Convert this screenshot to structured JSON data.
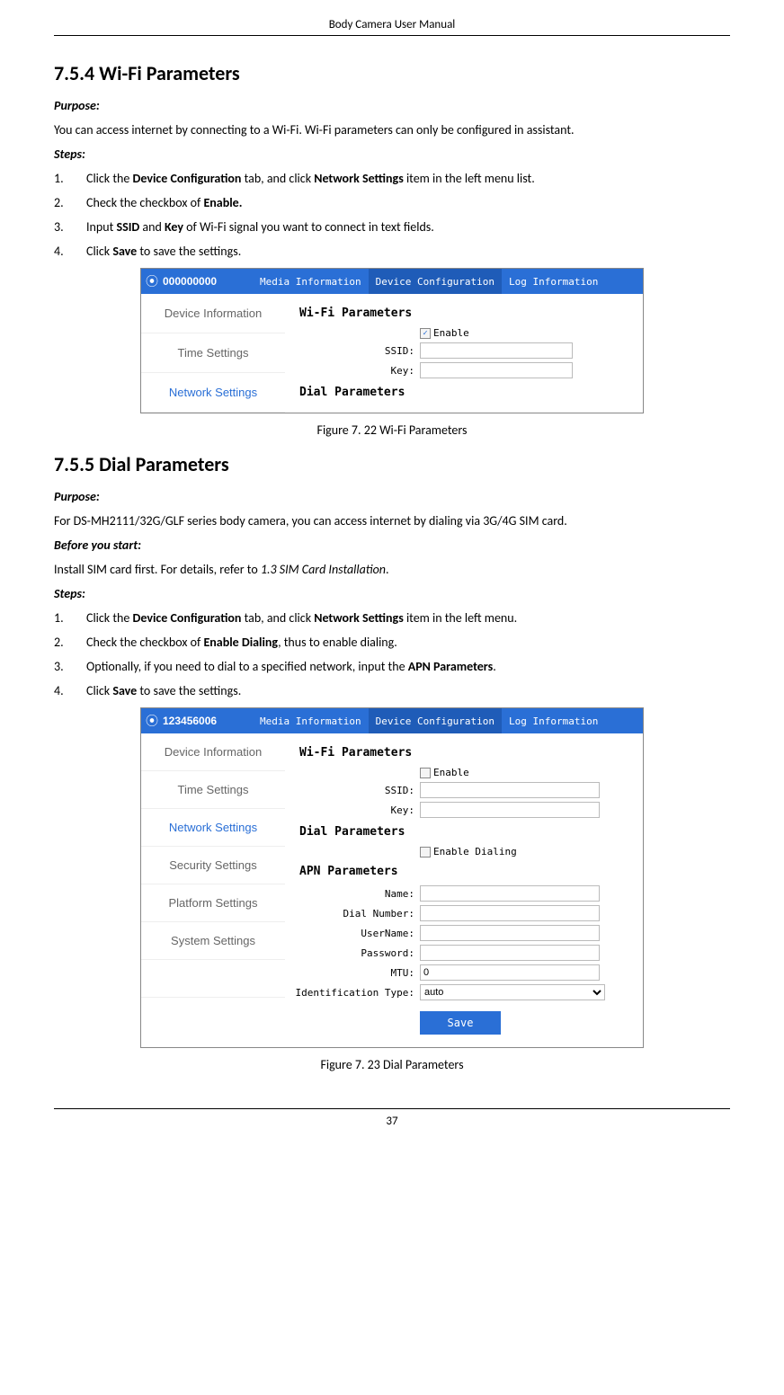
{
  "header": {
    "title": "Body Camera User Manual"
  },
  "section1": {
    "heading": "7.5.4  Wi-Fi Parameters",
    "purpose_label": "Purpose:",
    "purpose_text": "You can access internet by connecting to a Wi-Fi. Wi-Fi parameters can only be configured in assistant.",
    "steps_label": "Steps:",
    "steps": [
      {
        "pre": "Click the ",
        "b1": "Device Configuration",
        "mid": " tab, and click ",
        "b2": "Network Settings",
        "post": " item in the left menu list."
      },
      {
        "pre": "Check the checkbox of ",
        "b1": "Enable.",
        "mid": "",
        "b2": "",
        "post": ""
      },
      {
        "pre": "Input ",
        "b1": "SSID",
        "mid": " and ",
        "b2": "Key",
        "post": " of Wi-Fi signal you want to connect in text fields."
      },
      {
        "pre": "Click ",
        "b1": "Save",
        "mid": " to save the settings.",
        "b2": "",
        "post": ""
      }
    ],
    "figure_caption": "Figure 7. 22 Wi-Fi Parameters"
  },
  "shot1": {
    "device_id": "000000000",
    "tabs": [
      "Media Information",
      "Device Configuration",
      "Log Information"
    ],
    "sidebar": [
      "Device Information",
      "Time Settings",
      "Network Settings"
    ],
    "wifi_title": "Wi-Fi Parameters",
    "enable_label": "Enable",
    "enable_checked": true,
    "ssid_label": "SSID:",
    "ssid_value": "",
    "key_label": "Key:",
    "key_value": "",
    "dial_title": "Dial Parameters"
  },
  "section2": {
    "heading": "7.5.5  Dial Parameters",
    "purpose_label": "Purpose:",
    "purpose_text": "For DS-MH2111/32G/GLF series body camera, you can access internet by dialing via 3G/4G SIM card.",
    "before_label": "Before you start:",
    "before_text_pre": "Install SIM card first. For details, refer to ",
    "before_text_ref": "1.3 SIM Card Installation",
    "before_text_post": ".",
    "steps_label": "Steps:",
    "steps": [
      {
        "pre": "Click the ",
        "b1": "Device Configuration",
        "mid": " tab, and click ",
        "b2": "Network Settings",
        "post": " item in the left menu."
      },
      {
        "pre": "Check the checkbox of ",
        "b1": "Enable Dialing",
        "mid": ", thus to enable dialing.",
        "b2": "",
        "post": ""
      },
      {
        "pre": "Optionally, if you need to dial to a specified network, input the ",
        "b1": "APN Parameters",
        "mid": ".",
        "b2": "",
        "post": ""
      },
      {
        "pre": "Click ",
        "b1": "Save",
        "mid": " to save the settings.",
        "b2": "",
        "post": ""
      }
    ],
    "figure_caption": "Figure 7. 23 Dial Parameters"
  },
  "shot2": {
    "device_id": "123456006",
    "tabs": [
      "Media Information",
      "Device Configuration",
      "Log Information"
    ],
    "sidebar": [
      "Device Information",
      "Time Settings",
      "Network Settings",
      "Security Settings",
      "Platform Settings",
      "System Settings"
    ],
    "wifi_title": "Wi-Fi Parameters",
    "enable_label": "Enable",
    "enable_checked": false,
    "ssid_label": "SSID:",
    "ssid_value": "",
    "key_label": "Key:",
    "key_value": "",
    "dial_title": "Dial Parameters",
    "enable_dial_label": "Enable Dialing",
    "enable_dial_checked": false,
    "apn_title": "APN Parameters",
    "name_label": "Name:",
    "name_value": "",
    "dialnum_label": "Dial Number:",
    "dialnum_value": "",
    "username_label": "UserName:",
    "username_value": "",
    "password_label": "Password:",
    "password_value": "",
    "mtu_label": "MTU:",
    "mtu_value": "0",
    "idtype_label": "Identification Type:",
    "idtype_value": "auto",
    "save_label": "Save"
  },
  "page_number": "37"
}
